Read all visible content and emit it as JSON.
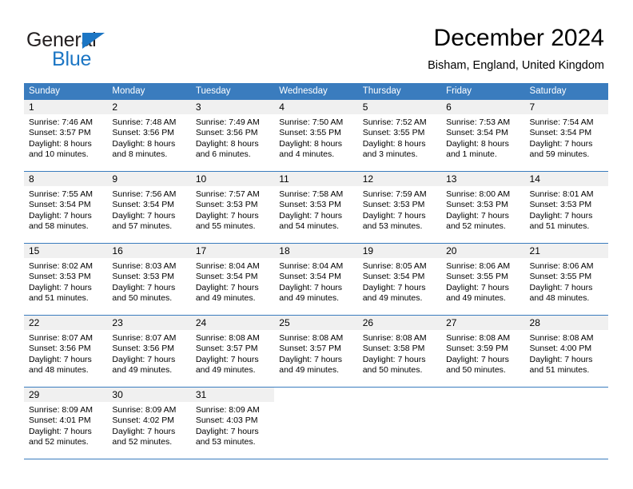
{
  "brand": {
    "name_part1": "General",
    "name_part2": "Blue",
    "accent_color": "#1c76c4",
    "text_color": "#231f20"
  },
  "header": {
    "title": "December 2024",
    "subtitle": "Bisham, England, United Kingdom"
  },
  "calendar": {
    "header_bg": "#3a7cbe",
    "daynum_bg": "#f0f0f0",
    "weekdays": [
      "Sunday",
      "Monday",
      "Tuesday",
      "Wednesday",
      "Thursday",
      "Friday",
      "Saturday"
    ],
    "weeks": [
      [
        {
          "day": "1",
          "sunrise": "Sunrise: 7:46 AM",
          "sunset": "Sunset: 3:57 PM",
          "daylight1": "Daylight: 8 hours",
          "daylight2": "and 10 minutes."
        },
        {
          "day": "2",
          "sunrise": "Sunrise: 7:48 AM",
          "sunset": "Sunset: 3:56 PM",
          "daylight1": "Daylight: 8 hours",
          "daylight2": "and 8 minutes."
        },
        {
          "day": "3",
          "sunrise": "Sunrise: 7:49 AM",
          "sunset": "Sunset: 3:56 PM",
          "daylight1": "Daylight: 8 hours",
          "daylight2": "and 6 minutes."
        },
        {
          "day": "4",
          "sunrise": "Sunrise: 7:50 AM",
          "sunset": "Sunset: 3:55 PM",
          "daylight1": "Daylight: 8 hours",
          "daylight2": "and 4 minutes."
        },
        {
          "day": "5",
          "sunrise": "Sunrise: 7:52 AM",
          "sunset": "Sunset: 3:55 PM",
          "daylight1": "Daylight: 8 hours",
          "daylight2": "and 3 minutes."
        },
        {
          "day": "6",
          "sunrise": "Sunrise: 7:53 AM",
          "sunset": "Sunset: 3:54 PM",
          "daylight1": "Daylight: 8 hours",
          "daylight2": "and 1 minute."
        },
        {
          "day": "7",
          "sunrise": "Sunrise: 7:54 AM",
          "sunset": "Sunset: 3:54 PM",
          "daylight1": "Daylight: 7 hours",
          "daylight2": "and 59 minutes."
        }
      ],
      [
        {
          "day": "8",
          "sunrise": "Sunrise: 7:55 AM",
          "sunset": "Sunset: 3:54 PM",
          "daylight1": "Daylight: 7 hours",
          "daylight2": "and 58 minutes."
        },
        {
          "day": "9",
          "sunrise": "Sunrise: 7:56 AM",
          "sunset": "Sunset: 3:54 PM",
          "daylight1": "Daylight: 7 hours",
          "daylight2": "and 57 minutes."
        },
        {
          "day": "10",
          "sunrise": "Sunrise: 7:57 AM",
          "sunset": "Sunset: 3:53 PM",
          "daylight1": "Daylight: 7 hours",
          "daylight2": "and 55 minutes."
        },
        {
          "day": "11",
          "sunrise": "Sunrise: 7:58 AM",
          "sunset": "Sunset: 3:53 PM",
          "daylight1": "Daylight: 7 hours",
          "daylight2": "and 54 minutes."
        },
        {
          "day": "12",
          "sunrise": "Sunrise: 7:59 AM",
          "sunset": "Sunset: 3:53 PM",
          "daylight1": "Daylight: 7 hours",
          "daylight2": "and 53 minutes."
        },
        {
          "day": "13",
          "sunrise": "Sunrise: 8:00 AM",
          "sunset": "Sunset: 3:53 PM",
          "daylight1": "Daylight: 7 hours",
          "daylight2": "and 52 minutes."
        },
        {
          "day": "14",
          "sunrise": "Sunrise: 8:01 AM",
          "sunset": "Sunset: 3:53 PM",
          "daylight1": "Daylight: 7 hours",
          "daylight2": "and 51 minutes."
        }
      ],
      [
        {
          "day": "15",
          "sunrise": "Sunrise: 8:02 AM",
          "sunset": "Sunset: 3:53 PM",
          "daylight1": "Daylight: 7 hours",
          "daylight2": "and 51 minutes."
        },
        {
          "day": "16",
          "sunrise": "Sunrise: 8:03 AM",
          "sunset": "Sunset: 3:53 PM",
          "daylight1": "Daylight: 7 hours",
          "daylight2": "and 50 minutes."
        },
        {
          "day": "17",
          "sunrise": "Sunrise: 8:04 AM",
          "sunset": "Sunset: 3:54 PM",
          "daylight1": "Daylight: 7 hours",
          "daylight2": "and 49 minutes."
        },
        {
          "day": "18",
          "sunrise": "Sunrise: 8:04 AM",
          "sunset": "Sunset: 3:54 PM",
          "daylight1": "Daylight: 7 hours",
          "daylight2": "and 49 minutes."
        },
        {
          "day": "19",
          "sunrise": "Sunrise: 8:05 AM",
          "sunset": "Sunset: 3:54 PM",
          "daylight1": "Daylight: 7 hours",
          "daylight2": "and 49 minutes."
        },
        {
          "day": "20",
          "sunrise": "Sunrise: 8:06 AM",
          "sunset": "Sunset: 3:55 PM",
          "daylight1": "Daylight: 7 hours",
          "daylight2": "and 49 minutes."
        },
        {
          "day": "21",
          "sunrise": "Sunrise: 8:06 AM",
          "sunset": "Sunset: 3:55 PM",
          "daylight1": "Daylight: 7 hours",
          "daylight2": "and 48 minutes."
        }
      ],
      [
        {
          "day": "22",
          "sunrise": "Sunrise: 8:07 AM",
          "sunset": "Sunset: 3:56 PM",
          "daylight1": "Daylight: 7 hours",
          "daylight2": "and 48 minutes."
        },
        {
          "day": "23",
          "sunrise": "Sunrise: 8:07 AM",
          "sunset": "Sunset: 3:56 PM",
          "daylight1": "Daylight: 7 hours",
          "daylight2": "and 49 minutes."
        },
        {
          "day": "24",
          "sunrise": "Sunrise: 8:08 AM",
          "sunset": "Sunset: 3:57 PM",
          "daylight1": "Daylight: 7 hours",
          "daylight2": "and 49 minutes."
        },
        {
          "day": "25",
          "sunrise": "Sunrise: 8:08 AM",
          "sunset": "Sunset: 3:57 PM",
          "daylight1": "Daylight: 7 hours",
          "daylight2": "and 49 minutes."
        },
        {
          "day": "26",
          "sunrise": "Sunrise: 8:08 AM",
          "sunset": "Sunset: 3:58 PM",
          "daylight1": "Daylight: 7 hours",
          "daylight2": "and 50 minutes."
        },
        {
          "day": "27",
          "sunrise": "Sunrise: 8:08 AM",
          "sunset": "Sunset: 3:59 PM",
          "daylight1": "Daylight: 7 hours",
          "daylight2": "and 50 minutes."
        },
        {
          "day": "28",
          "sunrise": "Sunrise: 8:08 AM",
          "sunset": "Sunset: 4:00 PM",
          "daylight1": "Daylight: 7 hours",
          "daylight2": "and 51 minutes."
        }
      ],
      [
        {
          "day": "29",
          "sunrise": "Sunrise: 8:09 AM",
          "sunset": "Sunset: 4:01 PM",
          "daylight1": "Daylight: 7 hours",
          "daylight2": "and 52 minutes."
        },
        {
          "day": "30",
          "sunrise": "Sunrise: 8:09 AM",
          "sunset": "Sunset: 4:02 PM",
          "daylight1": "Daylight: 7 hours",
          "daylight2": "and 52 minutes."
        },
        {
          "day": "31",
          "sunrise": "Sunrise: 8:09 AM",
          "sunset": "Sunset: 4:03 PM",
          "daylight1": "Daylight: 7 hours",
          "daylight2": "and 53 minutes."
        },
        {
          "day": "",
          "sunrise": "",
          "sunset": "",
          "daylight1": "",
          "daylight2": ""
        },
        {
          "day": "",
          "sunrise": "",
          "sunset": "",
          "daylight1": "",
          "daylight2": ""
        },
        {
          "day": "",
          "sunrise": "",
          "sunset": "",
          "daylight1": "",
          "daylight2": ""
        },
        {
          "day": "",
          "sunrise": "",
          "sunset": "",
          "daylight1": "",
          "daylight2": ""
        }
      ]
    ]
  }
}
